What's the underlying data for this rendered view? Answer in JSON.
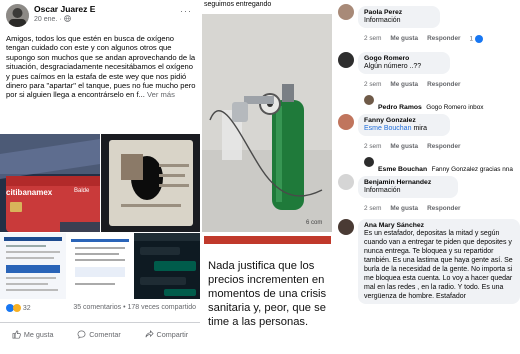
{
  "post": {
    "author": "Oscar Juarez E",
    "time": "20 ene.",
    "privacy_icon": "globe-icon",
    "more_label": "···",
    "text": "Amigos, todos los que estén en busca de oxígeno tengan cuidado con este y con algunos otros que supongo son muchos que se andan aprovechando de la situación, desgraciadamente necesitábamos el oxígeno y pues caímos en la estafa de este wey que nos pidió dinero para \"apartar\" el tanque, pues no fue mucho pero por si alguien llega a encontrárselo en f...",
    "see_more": "Ver más",
    "reaction_count": "32",
    "comments_shares": "35 comentarios • 178 veces compartido",
    "actions": {
      "like": "Me gusta",
      "comment": "Comentar",
      "share": "Compartir"
    },
    "card_label": "citibanamex",
    "card_side_label": "Balde"
  },
  "middle": {
    "caption": "seguimos entregando",
    "photo_footer": "6 com",
    "quote": "Nada justifica que los precios incrementen en momentos de una crisis sanitaria y, peor, que se time a las personas."
  },
  "comments": [
    {
      "name": "Paola Perez",
      "text": "Información",
      "time": "2 sem",
      "like": "Me gusta",
      "reply": "Responder",
      "reactions": "1"
    },
    {
      "name": "Gogo Romero",
      "text": "Algún número ..??",
      "time": "2 sem",
      "like": "Me gusta",
      "reply": "Responder"
    },
    {
      "reply_name": "Pedro Ramos",
      "reply_text": "Gogo Romero inbox"
    },
    {
      "name": "Fanny Gonzalez",
      "mention": "Esme Bouchan",
      "text": "mira",
      "time": "2 sem",
      "like": "Me gusta",
      "reply": "Responder"
    },
    {
      "reply_name": "Esme Bouchan",
      "reply_text": "Fanny Gonzalez gracias nna"
    },
    {
      "name": "Benjamin Hernandez",
      "text": "Información",
      "time": "2 sem",
      "like": "Me gusta",
      "reply": "Responder"
    },
    {
      "name": "Ana Mary Sánchez",
      "text": "Es un estafador, depositas la mitad y según cuando van a entregar te piden que deposites y nunca entrega. Te bloquea y su repartidor también. Es una lastima que haya gente así. Se burla de la necesidad de la gente. No importa si me bloquea esta cuenta. Lo voy a hacer quedar mal en las redes , en la radio. Y todo. Es una vergüenza de hombre. Estafador"
    }
  ],
  "colors": {
    "facebook_blue": "#1877f2",
    "quote_red": "#c0392b",
    "bubble_gray": "#f0f2f5",
    "meta_gray": "#65676b"
  }
}
